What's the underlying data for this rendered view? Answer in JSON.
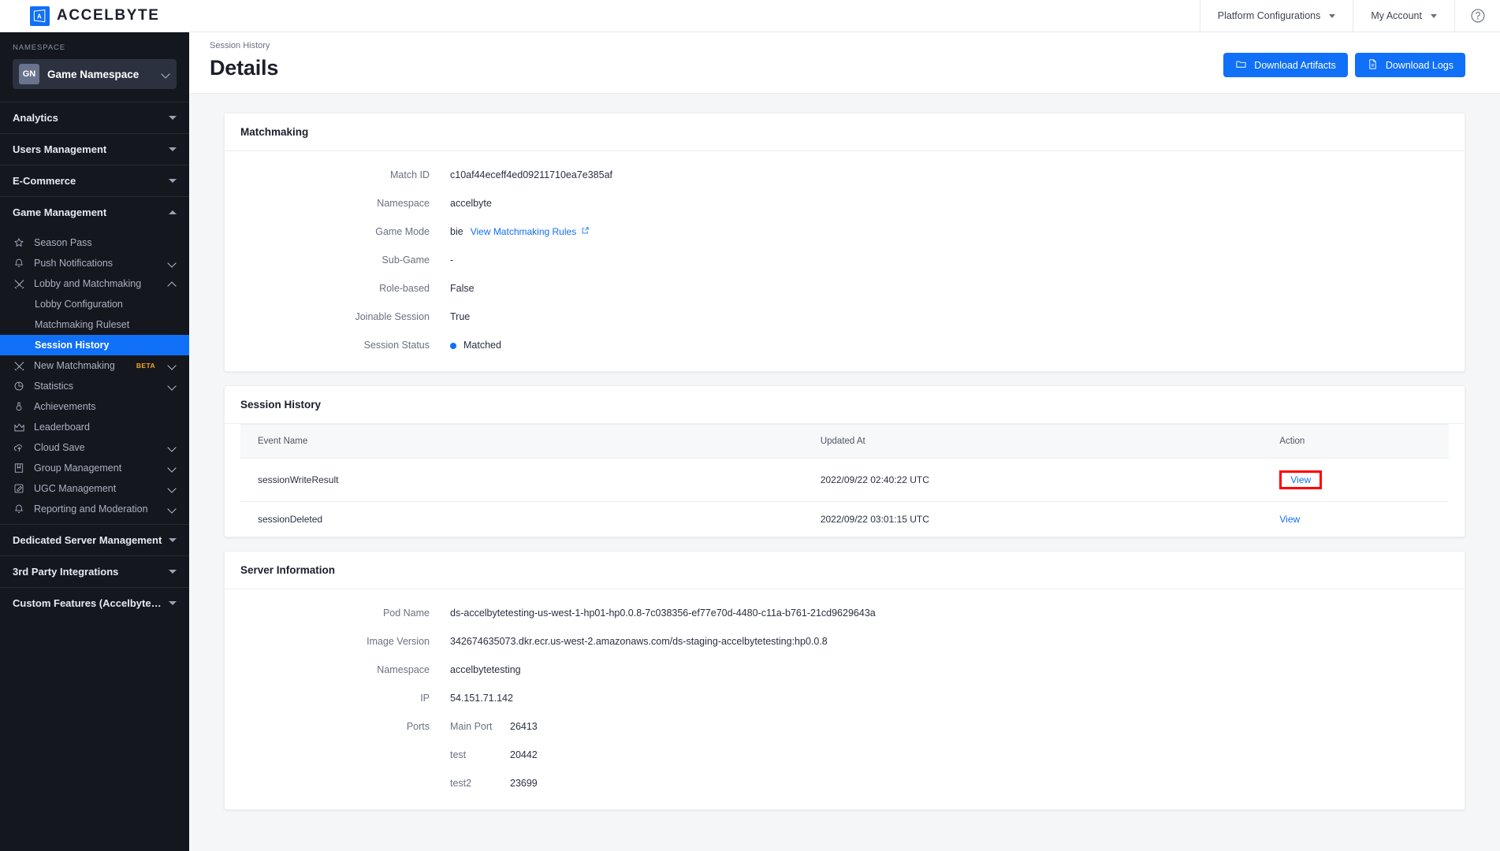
{
  "topbar": {
    "brand_name": "ACCELBYTE",
    "brand_icon": "accelbyte-logo-icon",
    "menu": [
      {
        "label": "Platform Configurations",
        "icon": "chevron-down-icon"
      },
      {
        "label": "My Account",
        "icon": "chevron-down-icon"
      }
    ],
    "help_icon": "help-circle-icon"
  },
  "sidebar": {
    "namespace_label": "NAMESPACE",
    "namespace_initials": "GN",
    "namespace_name": "Game Namespace",
    "sections": [
      {
        "label": "Analytics",
        "expanded": false
      },
      {
        "label": "Users Management",
        "expanded": false
      },
      {
        "label": "E-Commerce",
        "expanded": false
      }
    ],
    "game_management": {
      "label": "Game Management",
      "expanded": true,
      "items": [
        {
          "label": "Season Pass",
          "icon": "star-icon",
          "expandable": false
        },
        {
          "label": "Push Notifications",
          "icon": "bell-icon",
          "expandable": true
        },
        {
          "label": "Lobby and Matchmaking",
          "icon": "matchmaking-icon",
          "expandable": true,
          "expanded": true,
          "children": [
            {
              "label": "Lobby Configuration",
              "active": false
            },
            {
              "label": "Matchmaking Ruleset",
              "active": false
            },
            {
              "label": "Session History",
              "active": true
            }
          ]
        },
        {
          "label": "New Matchmaking",
          "icon": "matchmaking-icon",
          "expandable": true,
          "badge": "BETA"
        },
        {
          "label": "Statistics",
          "icon": "pie-chart-icon",
          "expandable": true
        },
        {
          "label": "Achievements",
          "icon": "medal-icon",
          "expandable": false
        },
        {
          "label": "Leaderboard",
          "icon": "crown-icon",
          "expandable": false
        },
        {
          "label": "Cloud Save",
          "icon": "cloud-upload-icon",
          "expandable": true
        },
        {
          "label": "Group Management",
          "icon": "group-icon",
          "expandable": true
        },
        {
          "label": "UGC Management",
          "icon": "edit-square-icon",
          "expandable": true
        },
        {
          "label": "Reporting and Moderation",
          "icon": "bell-icon",
          "expandable": true
        }
      ]
    },
    "bottom_sections": [
      {
        "label": "Dedicated Server Management",
        "expanded": false
      },
      {
        "label": "3rd Party Integrations",
        "expanded": false
      },
      {
        "label": "Custom Features (Accelbyte In...",
        "expanded": false
      }
    ]
  },
  "page": {
    "breadcrumb": "Session History",
    "title": "Details",
    "actions": [
      {
        "label": "Download Artifacts",
        "icon": "folder-icon"
      },
      {
        "label": "Download Logs",
        "icon": "document-icon"
      }
    ]
  },
  "matchmaking": {
    "title": "Matchmaking",
    "rows": [
      {
        "key": "Match ID",
        "value": "c10af44eceff4ed09211710ea7e385af"
      },
      {
        "key": "Namespace",
        "value": "accelbyte"
      },
      {
        "key": "Game Mode",
        "value": "bie",
        "link": "View Matchmaking Rules",
        "link_icon": "external-link-icon"
      },
      {
        "key": "Sub-Game",
        "value": "-"
      },
      {
        "key": "Role-based",
        "value": "False"
      },
      {
        "key": "Joinable Session",
        "value": "True"
      },
      {
        "key": "Session Status",
        "value": "Matched",
        "status_color": "#1070f8"
      }
    ]
  },
  "session_history": {
    "title": "Session History",
    "columns": [
      "Event Name",
      "Updated At",
      "Action"
    ],
    "rows": [
      {
        "event": "sessionWriteResult",
        "updated": "2022/09/22 02:40:22 UTC",
        "action": "View",
        "highlighted": true
      },
      {
        "event": "sessionDeleted",
        "updated": "2022/09/22 03:01:15 UTC",
        "action": "View",
        "highlighted": false
      }
    ]
  },
  "server_information": {
    "title": "Server Information",
    "rows": [
      {
        "key": "Pod Name",
        "value": "ds-accelbytetesting-us-west-1-hp01-hp0.0.8-7c038356-ef77e70d-4480-c11a-b761-21cd9629643a"
      },
      {
        "key": "Image Version",
        "value": "342674635073.dkr.ecr.us-west-2.amazonaws.com/ds-staging-accelbytetesting:hp0.0.8"
      },
      {
        "key": "Namespace",
        "value": "accelbytetesting"
      },
      {
        "key": "IP",
        "value": "54.151.71.142"
      }
    ],
    "ports_label": "Ports",
    "ports": [
      {
        "name": "Main Port",
        "value": "26413"
      },
      {
        "name": "test",
        "value": "20442"
      },
      {
        "name": "test2",
        "value": "23699"
      }
    ]
  },
  "colors": {
    "accent": "#1070f8",
    "sidebar_bg": "#15171f",
    "highlight_box": "#ff0000"
  }
}
